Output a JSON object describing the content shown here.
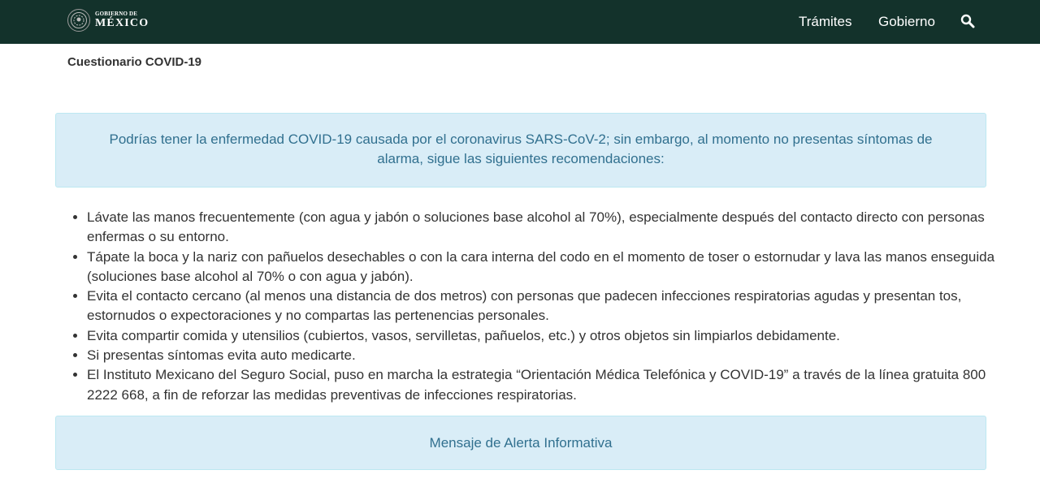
{
  "header": {
    "logo": {
      "top_text": "GOBIERNO DE",
      "main_text": "MÉXICO",
      "icon": "seal-icon"
    },
    "nav": [
      {
        "label": "Trámites"
      },
      {
        "label": "Gobierno"
      }
    ],
    "search_icon": "search-icon"
  },
  "breadcrumb": "Cuestionario COVID-19",
  "alert_main": "Podrías tener la enfermedad COVID-19 causada por el coronavirus SARS-CoV-2; sin embargo, al momento no presentas síntomas de alarma, sigue las siguientes recomendaciones:",
  "recommendations": [
    "Lávate las manos frecuentemente (con agua y jabón o soluciones base alcohol al 70%), especialmente después del contacto directo con personas enfermas o su entorno.",
    "Tápate la boca y la nariz con pañuelos desechables o con la cara interna del codo en el momento de toser o estornudar y lava las manos enseguida (soluciones base alcohol al 70% o con agua y jabón).",
    "Evita el contacto cercano (al menos una distancia de dos metros) con personas que padecen infecciones respiratorias agudas y presentan tos, estornudos o expectoraciones y no compartas las pertenencias personales.",
    "Evita compartir comida y utensilios (cubiertos, vasos, servilletas, pañuelos, etc.) y otros objetos sin limpiarlos debidamente.",
    "Si presentas síntomas evita auto medicarte.",
    "El Instituto Mexicano del Seguro Social, puso en marcha la estrategia “Orientación Médica Telefónica y COVID-19” a través de la línea gratuita 800 2222 668, a fin de reforzar las medidas preventivas de infecciones respiratorias."
  ],
  "alert_info": "Mensaje de Alerta Informativa",
  "colors": {
    "navbar_bg": "#13322b",
    "alert_bg": "#d9edf7",
    "alert_border": "#bce8f1",
    "alert_text": "#31708f"
  }
}
